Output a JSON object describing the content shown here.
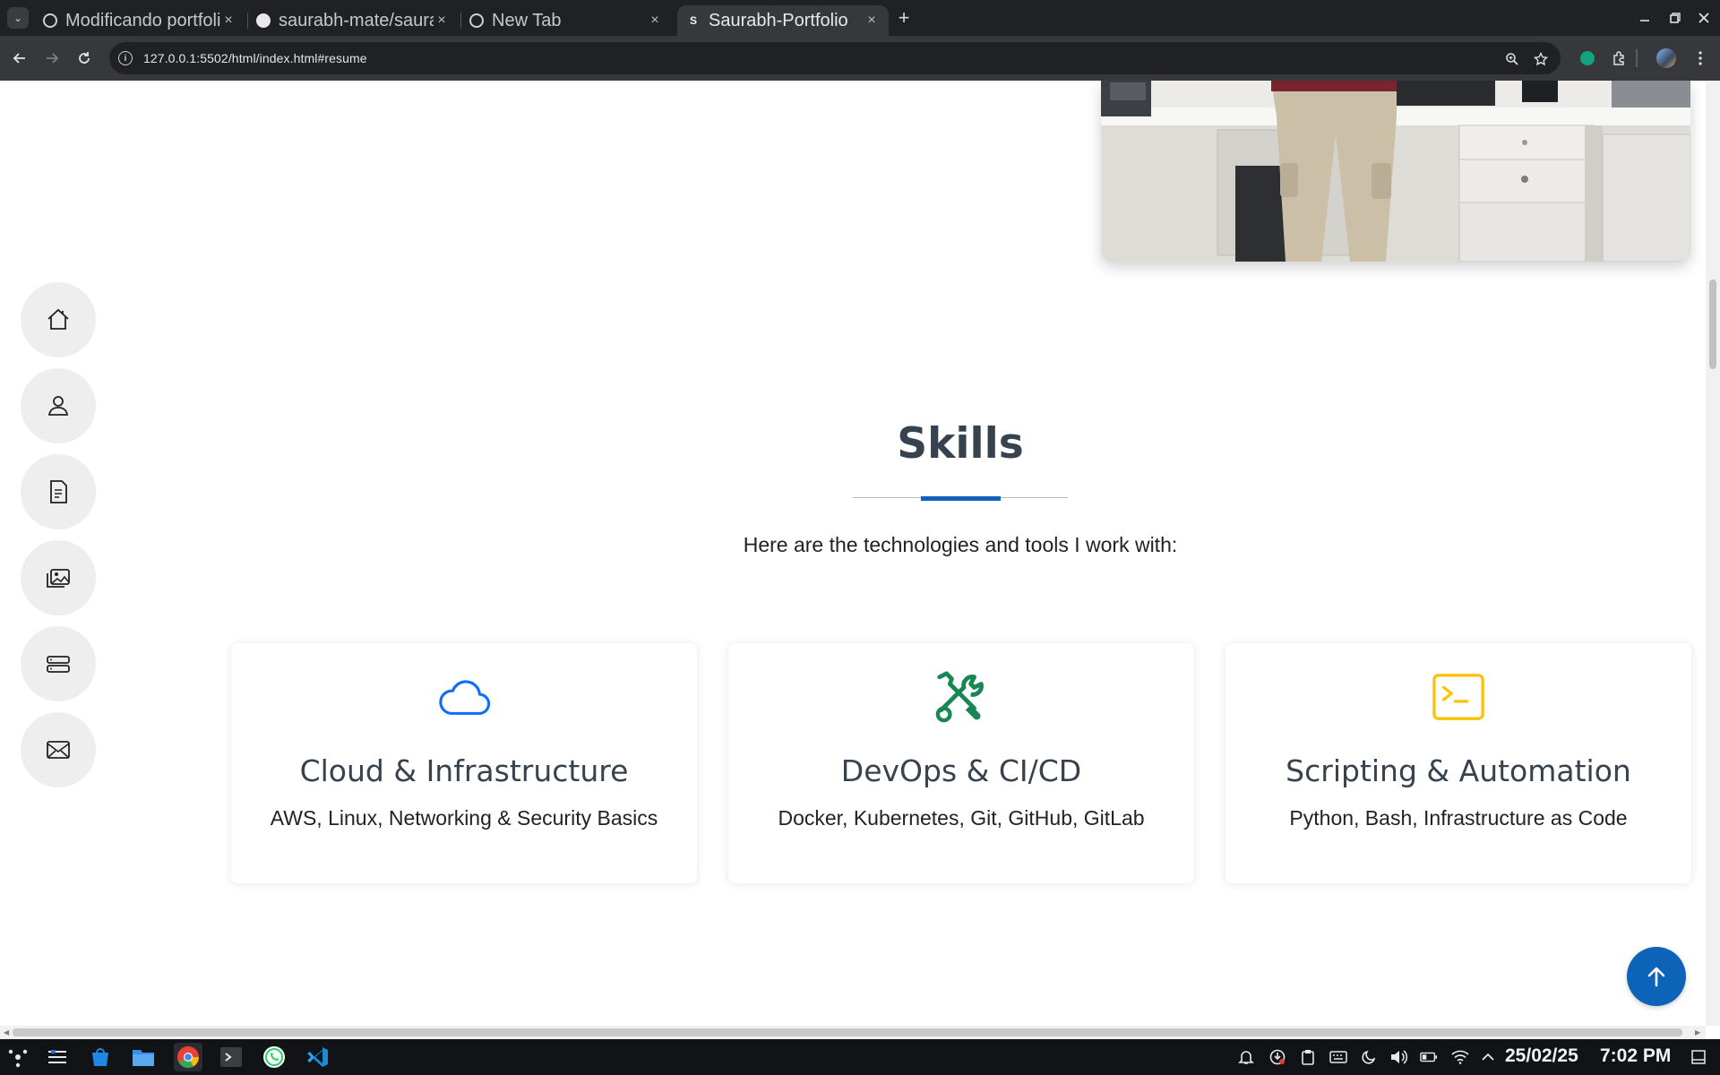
{
  "browser": {
    "tabs": [
      {
        "title": "Modificando portfolio",
        "close": "×"
      },
      {
        "title": "saurabh-mate/saurabh-portfolio",
        "close": "×"
      },
      {
        "title": "New Tab",
        "close": "×"
      },
      {
        "title": "Saurabh-Portfolio",
        "close": "×",
        "favicon_letter": "S"
      }
    ],
    "url": "127.0.0.1:5502/html/index.html#resume"
  },
  "skills": {
    "title": "Skills",
    "subtitle": "Here are the technologies and tools I work with:",
    "cards": [
      {
        "name": "Cloud & Infrastructure",
        "desc": "AWS, Linux, Networking & Security Basics",
        "icon": "cloud-icon",
        "color": "#0d6efd"
      },
      {
        "name": "DevOps & CI/CD",
        "desc": "Docker, Kubernetes, Git, GitHub, GitLab",
        "icon": "tools-icon",
        "color": "#198754"
      },
      {
        "name": "Scripting & Automation",
        "desc": "Python, Bash, Infrastructure as Code",
        "icon": "terminal-icon",
        "color": "#ffc107"
      }
    ]
  },
  "side_nav": [
    "home-icon",
    "person-icon",
    "file-text-icon",
    "images-icon",
    "server-icon",
    "envelope-icon"
  ],
  "taskbar": {
    "date": "25/02/25",
    "time": "7:02 PM"
  },
  "colors": {
    "accent": "#0d63b8",
    "heading": "#37424f"
  }
}
